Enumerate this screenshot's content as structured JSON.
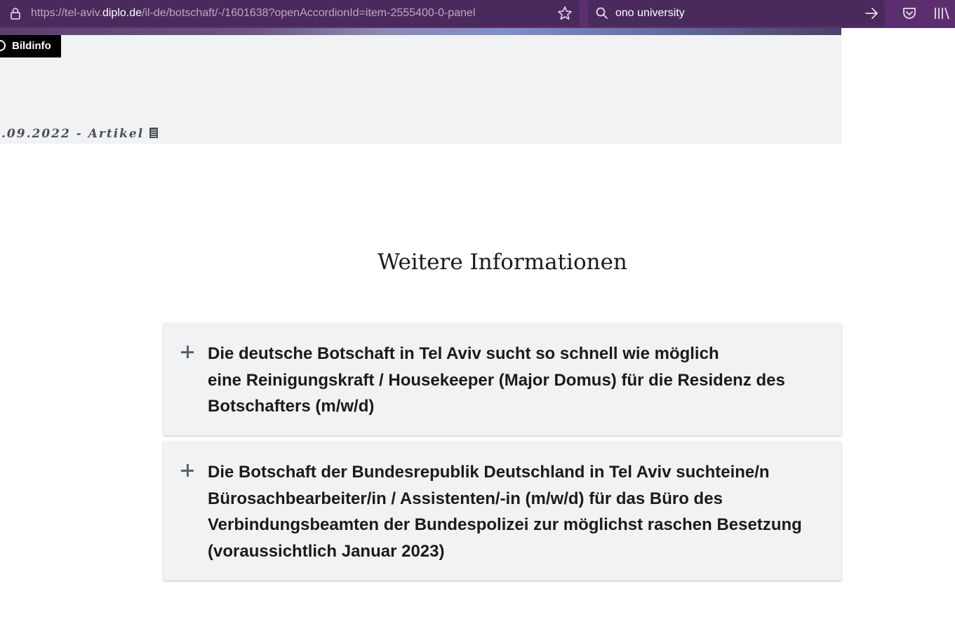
{
  "browser": {
    "url_prefix": "https://tel-aviv.",
    "url_host": "diplo.de",
    "url_path": "/il-de/botschaft/-/1601638?openAccordionId=item-2555400-0-panel",
    "search_value": "ono university",
    "icons": [
      "lock-icon",
      "star-icon",
      "search-icon",
      "go-arrow-icon",
      "pocket-icon",
      "library-icon"
    ]
  },
  "hero": {
    "bildinfo_label": "Bildinfo",
    "meta_text": ".09.2022 - Artikel"
  },
  "section": {
    "title": "Weitere Informationen",
    "accordion": [
      {
        "lines": [
          "Die deutsche Botschaft in Tel Aviv sucht so schnell wie möglich",
          "eine Reinigungskraft / Housekeeper (Major Domus) für die Residenz des",
          "Botschafters (m/w/d)"
        ]
      },
      {
        "lines": [
          "Die Botschaft der Bundesrepublik Deutschland in Tel Aviv suchteine/n",
          "Bürosachbearbeiter/in / Assistenten/-in (m/w/d) für das Büro des",
          "Verbindungsbeamten der Bundespolizei zur möglichst raschen Besetzung",
          "(voraussichtlich Januar 2023)"
        ]
      }
    ]
  },
  "colors": {
    "toolbar": "#5b2f6e",
    "urlbar": "#4a2a5c",
    "panel": "#f1f2f3",
    "text": "#1b1b1b"
  }
}
